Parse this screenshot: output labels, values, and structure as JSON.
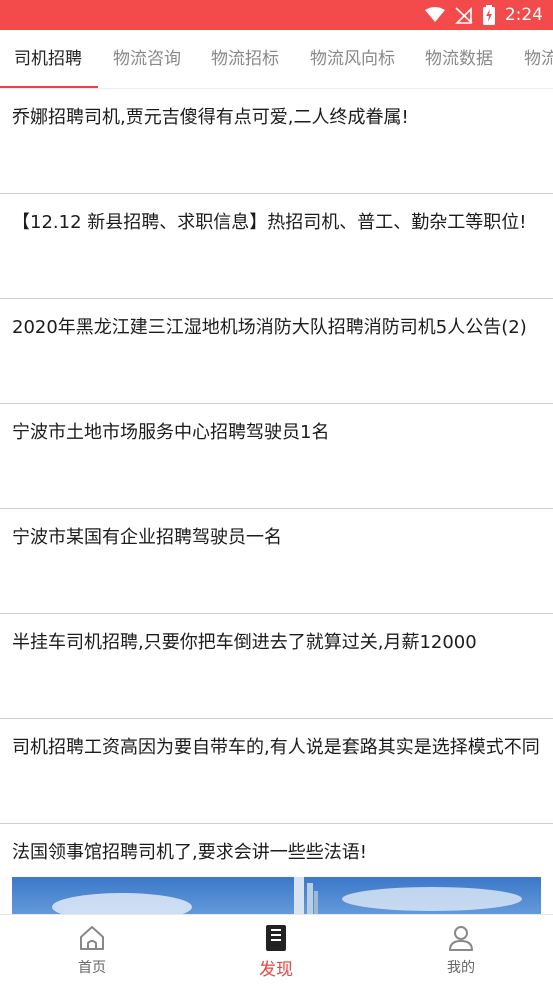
{
  "status_bar": {
    "time": "2:24"
  },
  "tabs": [
    {
      "label": "司机招聘",
      "active": true
    },
    {
      "label": "物流咨询"
    },
    {
      "label": "物流招标"
    },
    {
      "label": "物流风向标"
    },
    {
      "label": "物流数据"
    },
    {
      "label": "物流"
    }
  ],
  "articles": [
    {
      "title": "乔娜招聘司机,贾元吉傻得有点可爱,二人终成眷属!"
    },
    {
      "title": "【12.12 新县招聘、求职信息】热招司机、普工、勤杂工等职位!"
    },
    {
      "title": "2020年黑龙江建三江湿地机场消防大队招聘消防司机5人公告(2)"
    },
    {
      "title": "宁波市土地市场服务中心招聘驾驶员1名"
    },
    {
      "title": "宁波市某国有企业招聘驾驶员一名"
    },
    {
      "title": "半挂车司机招聘,只要你把车倒进去了就算过关,月薪12000"
    },
    {
      "title": "司机招聘工资高因为要自带车的,有人说是套路其实是选择模式不同"
    },
    {
      "title": "法国领事馆招聘司机了,要求会讲一些些法语!"
    }
  ],
  "bottom_nav": [
    {
      "label": "首页",
      "icon": "home-icon"
    },
    {
      "label": "发现",
      "icon": "document-icon",
      "active": true
    },
    {
      "label": "我的",
      "icon": "user-icon"
    }
  ],
  "colors": {
    "accent": "#e94444",
    "status_bar": "#f34b4b"
  }
}
